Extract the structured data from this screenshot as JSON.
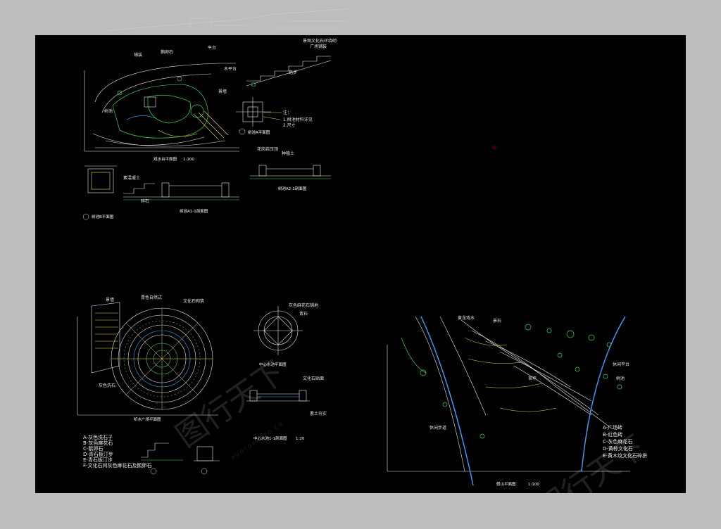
{
  "plans": {
    "p1_title": "戏水台平面图",
    "p1_scale": "1:100",
    "p2_title": "树池A平面图",
    "p3_title": "树池A2-2剖面图",
    "p4_title": "树池B平面图",
    "p5_title": "树池A1-1剖面图",
    "p6_title": "听水广场平面图",
    "p7_title": "中心水池平面图",
    "p8_title": "中心水池1-1剖面图",
    "p8_scale": "1:20",
    "p9_title": "假山平面图",
    "p9_scale": "1:100",
    "p10_title": "黄龙戏水",
    "p11_label": "素土夯实"
  },
  "legend_left": [
    "A-灰色洗石子",
    "B-灰色麻花石",
    "C-鹅卵石",
    "D-青石板汀步",
    "E-青石板汀步",
    "F-文化石间灰色麻花石及鹅卵石"
  ],
  "legend_right": [
    "A-广场砖",
    "B-红色砖",
    "C-灰色麻花石",
    "D-黄棕文化石",
    "E-黄木纹文化石碎拼"
  ],
  "watermark": {
    "cn": "图行天下",
    "en": "PHOTOPHOTO.CN"
  },
  "colors": {
    "sheet": "#000000",
    "line_white": "#e8e8e8",
    "line_green": "#39d353",
    "line_blue": "#3aa0ff",
    "line_yellow": "#e8d84a",
    "line_red": "#ff4040"
  }
}
